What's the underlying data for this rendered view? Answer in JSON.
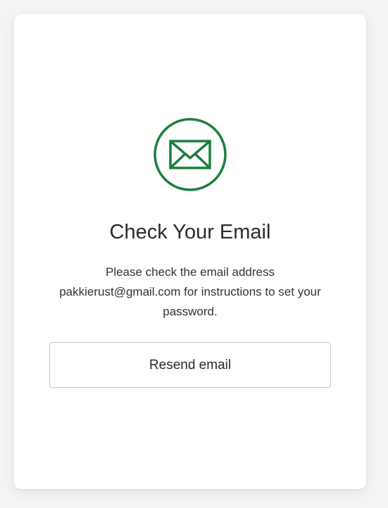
{
  "card": {
    "icon": "envelope-icon",
    "title": "Check Your Email",
    "message_line1": "Please check the email address",
    "message_line2": "pakkierust@gmail.com for instructions to set your",
    "message_line3": "password.",
    "resend_label": "Resend email"
  },
  "colors": {
    "accent": "#1a7f3c",
    "card_background": "#ffffff",
    "page_background": "#f4f4f4"
  }
}
